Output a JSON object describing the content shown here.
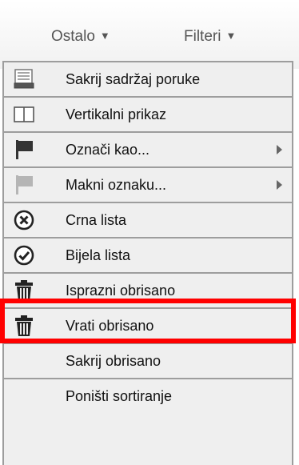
{
  "toolbar": {
    "ostalo_label": "Ostalo",
    "filteri_label": "Filteri"
  },
  "menu": {
    "items": [
      {
        "label": "Sakrij sadržaj poruke",
        "icon": "hide-content-icon"
      },
      {
        "label": "Vertikalni prikaz",
        "icon": "vertical-view-icon"
      },
      {
        "label": "Označi kao...",
        "icon": "flag-dark-icon",
        "submenu": true
      },
      {
        "label": "Makni oznaku...",
        "icon": "flag-light-icon",
        "submenu": true
      },
      {
        "label": "Crna lista",
        "icon": "blacklist-x-icon"
      },
      {
        "label": "Bijela lista",
        "icon": "whitelist-check-icon"
      },
      {
        "label": "Isprazni obrisano",
        "icon": "trash-icon",
        "highlighted": true
      },
      {
        "label": "Vrati obrisano",
        "icon": "trash-icon"
      },
      {
        "label": "Sakrij obrisano",
        "icon": ""
      },
      {
        "label": "Poništi sortiranje",
        "icon": ""
      }
    ]
  },
  "colors": {
    "highlight": "#ff0000",
    "menu_background": "#efefef",
    "border": "#9d9d9d"
  }
}
